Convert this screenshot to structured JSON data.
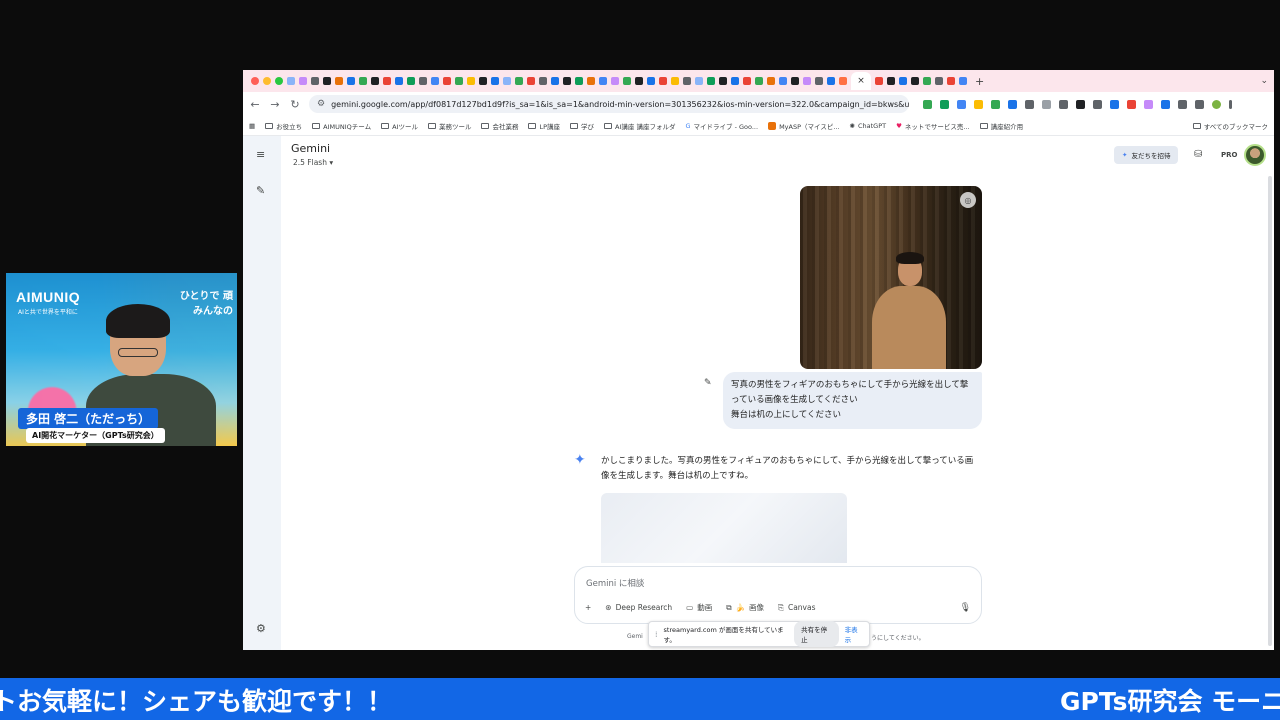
{
  "presenter": {
    "brand": "AIMUNIQ",
    "brand_sub": "AIと共で世界を平和に",
    "slogan_line1": "ひとりで 頑",
    "slogan_line2": "みんなの",
    "name": "多田 啓二（ただっち）",
    "role": "AI開花マーケター（GPTs研究会）"
  },
  "browser": {
    "url": "gemini.google.com/app/df0817d127bd1d9f?is_sa=1&is_sa=1&android-min-version=301356232&ios-min-version=322.0&campaign_id=bkws&utm_source=sem&...",
    "active_tab_close": "×",
    "new_tab": "+",
    "bookmarks": [
      "お役立ち",
      "AIMUNIQチーム",
      "AIツール",
      "業務ツール",
      "会社業務",
      "LP講座",
      "学び",
      "AI講座 講座フォルダ",
      "マイドライブ - Goo...",
      "MyASP（マイスピ...",
      "ChatGPT",
      "ネットでサービス売...",
      "講座紹介用"
    ],
    "all_bookmarks": "すべてのブックマーク"
  },
  "gemini": {
    "title": "Gemini",
    "model": "2.5 Flash",
    "invite_label": "友だちを招待",
    "pro_label": "PRO",
    "user_prompt_line1": "写真の男性をフィギアのおもちゃにして手から光線を出して撃",
    "user_prompt_line2": "っている画像を生成してください",
    "user_prompt_line3": "舞台は机の上にしてください",
    "reply_line1": "かしこまりました。写真の男性をフィギュアのおもちゃにして、手から光線を出して撃っている画",
    "reply_line2": "像を生成します。舞台は机の上ですね。",
    "composer_placeholder": "Gemini に相談",
    "tools": {
      "deep_research": "Deep Research",
      "video": "動画",
      "image": "画像",
      "canvas": "Canvas"
    },
    "footnote_left": "Gemi",
    "footnote_right": "うにしてください。"
  },
  "share_bar": {
    "message": "streamyard.com が画面を共有しています。",
    "stop": "共有を停止",
    "hide": "非表示"
  },
  "ticker": {
    "left": "トお気軽に！シェアも歓迎です！！",
    "right": "GPTs研究会 モーニ"
  },
  "colors": {
    "ticker_bg": "#1267e6",
    "tabstrip_bg": "#fce6ec",
    "gemini_spark": "#4a82f0",
    "name_badge": "#1565d8"
  }
}
